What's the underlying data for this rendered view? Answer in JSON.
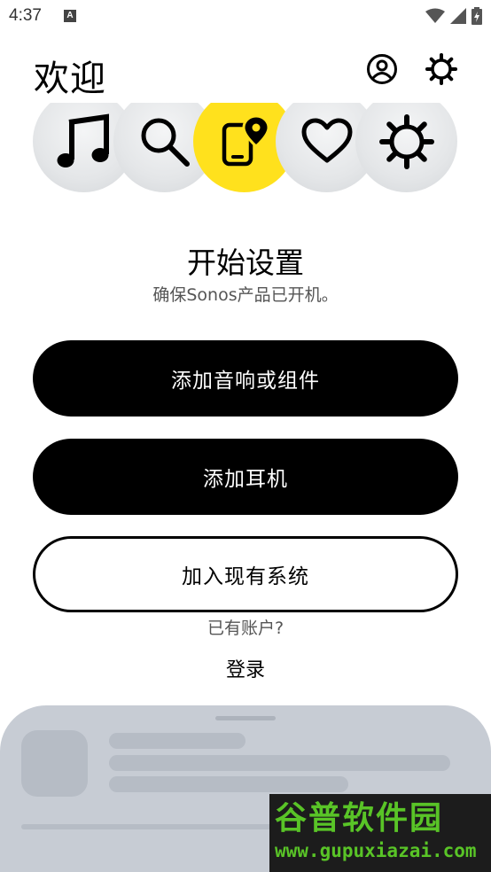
{
  "status_bar": {
    "time": "4:37",
    "notification_icon": "A",
    "icons": [
      "wifi-icon",
      "signal-icon",
      "battery-charging-icon"
    ]
  },
  "header": {
    "title": "欢迎",
    "account_icon": "account-circle-icon",
    "settings_icon": "settings-gear-icon"
  },
  "hero": {
    "icons": [
      "music-note-icon",
      "search-icon",
      "phone-location-icon",
      "heart-icon",
      "gear-icon"
    ],
    "active_index": 2,
    "active_color": "#FFE11D"
  },
  "setup": {
    "title": "开始设置",
    "subtitle": "确保Sonos产品已开机。"
  },
  "buttons": {
    "add_speaker": "添加音响或组件",
    "add_headphones": "添加耳机",
    "join_system": "加入现有系统"
  },
  "account": {
    "question": "已有账户?",
    "login": "登录"
  },
  "watermark": {
    "top": "谷普软件园",
    "bottom": "www.gupuxiazai.com"
  }
}
